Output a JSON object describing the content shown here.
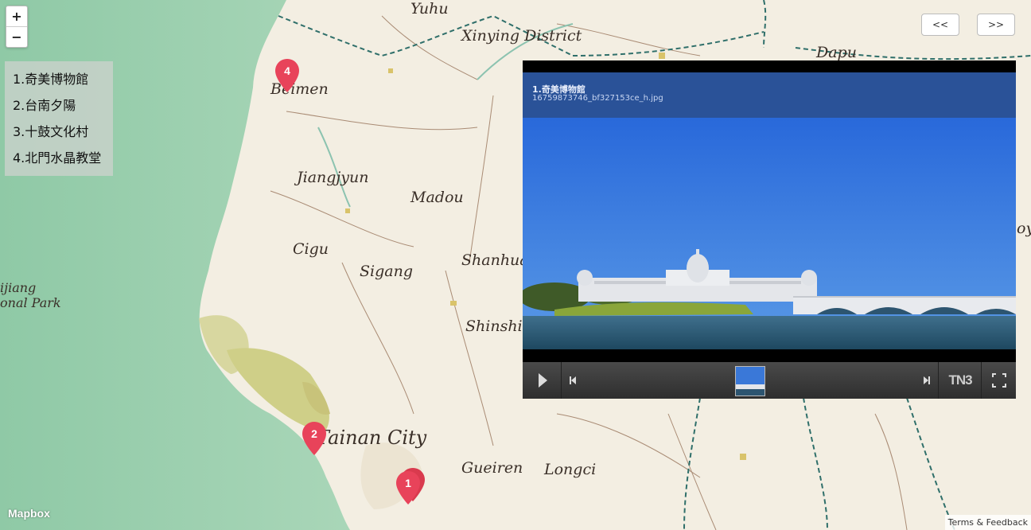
{
  "map": {
    "zoom_in": "+",
    "zoom_out": "−",
    "places": [
      {
        "name": "Yuhu"
      },
      {
        "name": "Xinying District"
      },
      {
        "name": "Dapu"
      },
      {
        "name": "Beimen"
      },
      {
        "name": "Jiangjyun"
      },
      {
        "name": "Madou"
      },
      {
        "name": "Cigu"
      },
      {
        "name": "Sigang"
      },
      {
        "name": "Shanhua"
      },
      {
        "name": "Shinshi"
      },
      {
        "name": "Tainan City"
      },
      {
        "name": "Gueiren"
      },
      {
        "name": "Longci"
      },
      {
        "name": "ijiang"
      },
      {
        "name": "onal Park"
      },
      {
        "name": "oy"
      }
    ],
    "markers": [
      {
        "label": "1",
        "color": "#e8435a"
      },
      {
        "label": "2",
        "color": "#e8435a"
      },
      {
        "label": "4",
        "color": "#e8435a"
      }
    ],
    "attribution_logo": "Mapbox",
    "terms": "Terms & Feedback"
  },
  "poi_list": {
    "items": [
      "1.奇美博物館",
      "2.台南夕陽",
      "3.十鼓文化村",
      "4.北門水晶教堂"
    ]
  },
  "pager": {
    "prev": "<<",
    "next": ">>"
  },
  "slideshow": {
    "title": "1.奇美博物館",
    "filename": "16759873746_bf327153ce_h.jpg",
    "brand": "TN3",
    "icons": [
      "play-icon",
      "skip-back-icon",
      "skip-forward-icon",
      "fullscreen-icon"
    ]
  }
}
